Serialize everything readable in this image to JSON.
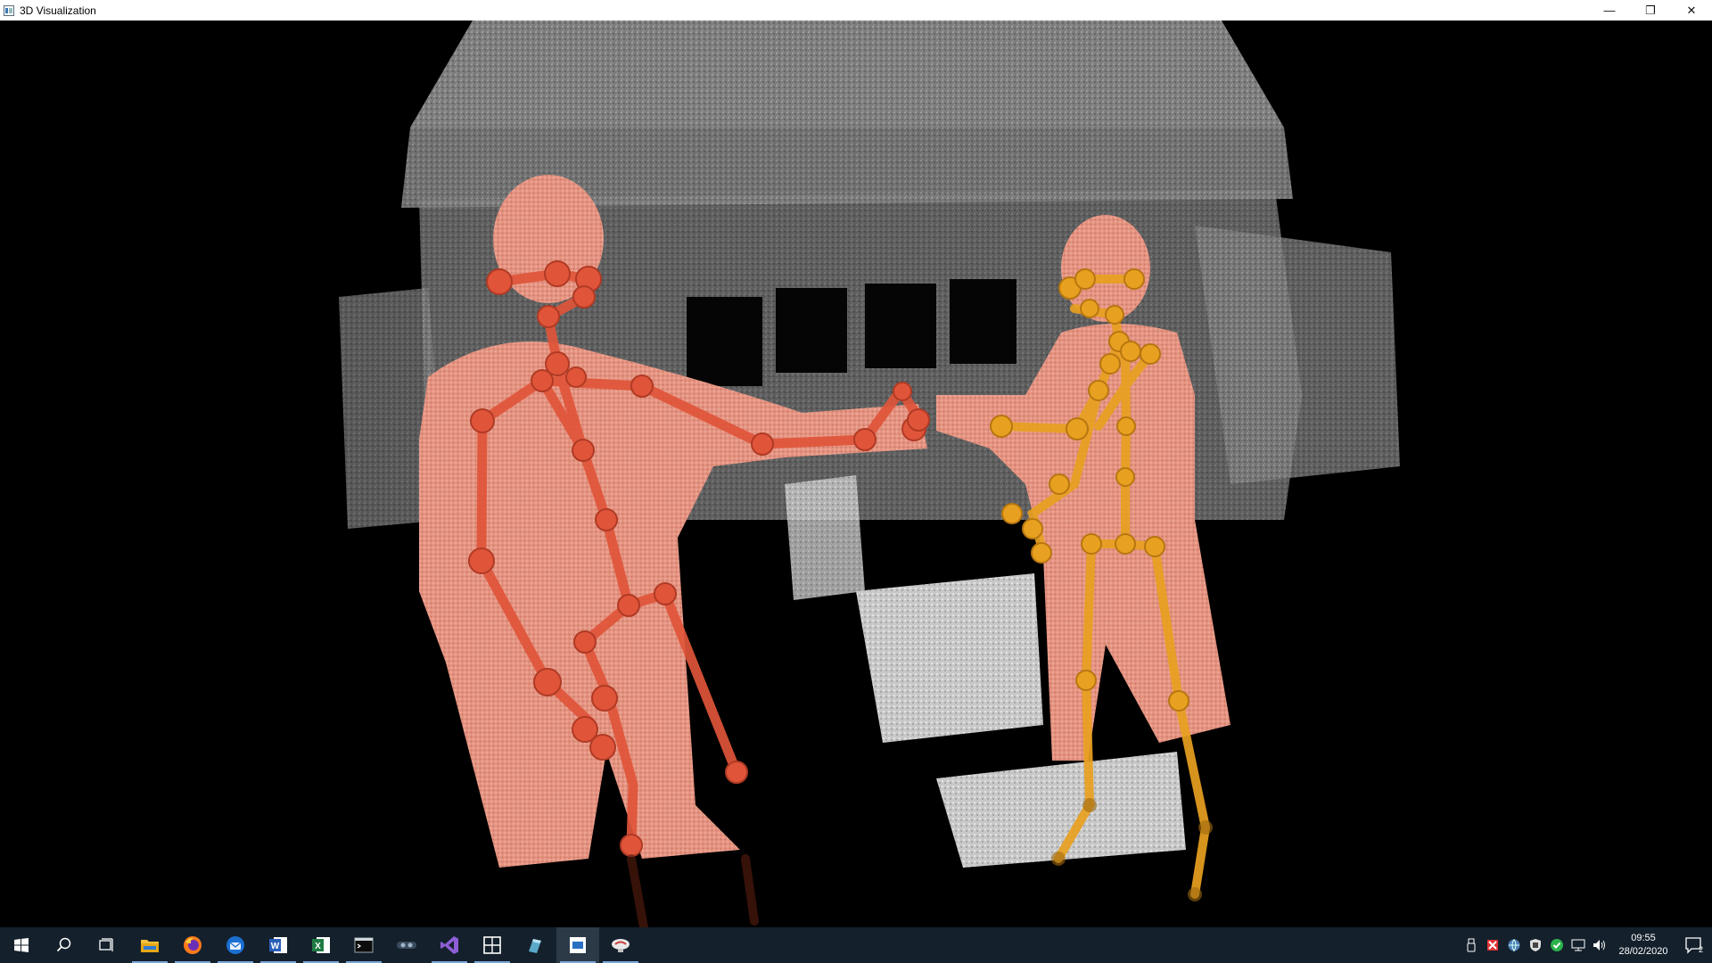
{
  "window": {
    "title": "3D Visualization",
    "minimize_label": "—",
    "restore_label": "❐",
    "close_label": "✕"
  },
  "scene": {
    "description_icon": "point-cloud-scene",
    "colors": {
      "background": "#000000",
      "point_cloud": "#8a8a8a",
      "body_point_cloud": "#e8907e",
      "skeleton_left": "#e0553a",
      "skeleton_right": "#e8a020"
    }
  },
  "taskbar": {
    "items": [
      {
        "icon": "windows-start-icon"
      },
      {
        "icon": "search-icon"
      },
      {
        "icon": "task-view-icon"
      },
      {
        "icon": "file-explorer-icon"
      },
      {
        "icon": "firefox-icon"
      },
      {
        "icon": "thunderbird-icon"
      },
      {
        "icon": "word-icon"
      },
      {
        "icon": "excel-icon"
      },
      {
        "icon": "terminal-icon"
      },
      {
        "icon": "app-icon"
      },
      {
        "icon": "visual-studio-icon"
      },
      {
        "icon": "snip-tool-icon"
      },
      {
        "icon": "app-icon"
      },
      {
        "icon": "3d-visualization-icon"
      },
      {
        "icon": "app-icon"
      }
    ],
    "clock_time": "09:55",
    "clock_date": "28/02/2020",
    "notification_count": "2"
  }
}
